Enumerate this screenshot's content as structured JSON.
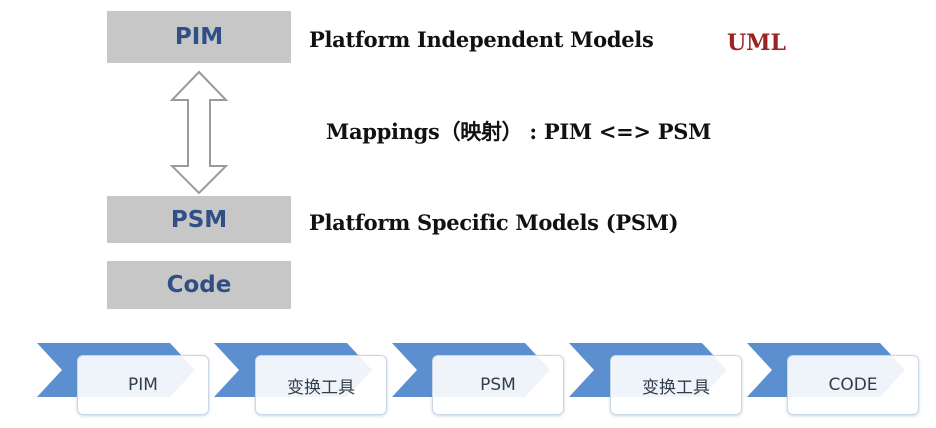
{
  "levels": {
    "pim": "PIM",
    "psm": "PSM",
    "code": "Code"
  },
  "descriptions": {
    "pim": "Platform  Independent  Models",
    "uml": "UML",
    "mapping": "Mappings（映射） : PIM <=> PSM",
    "psm": "Platform  Specific  Models  (PSM)"
  },
  "flow": {
    "steps": [
      "PIM",
      "变换工具",
      "PSM",
      "变换工具",
      "CODE"
    ]
  },
  "colors": {
    "box_fill": "#c7c7c7",
    "box_text": "#2f4f86",
    "uml_text": "#9b2323",
    "chevron": "#5b8fd0"
  }
}
